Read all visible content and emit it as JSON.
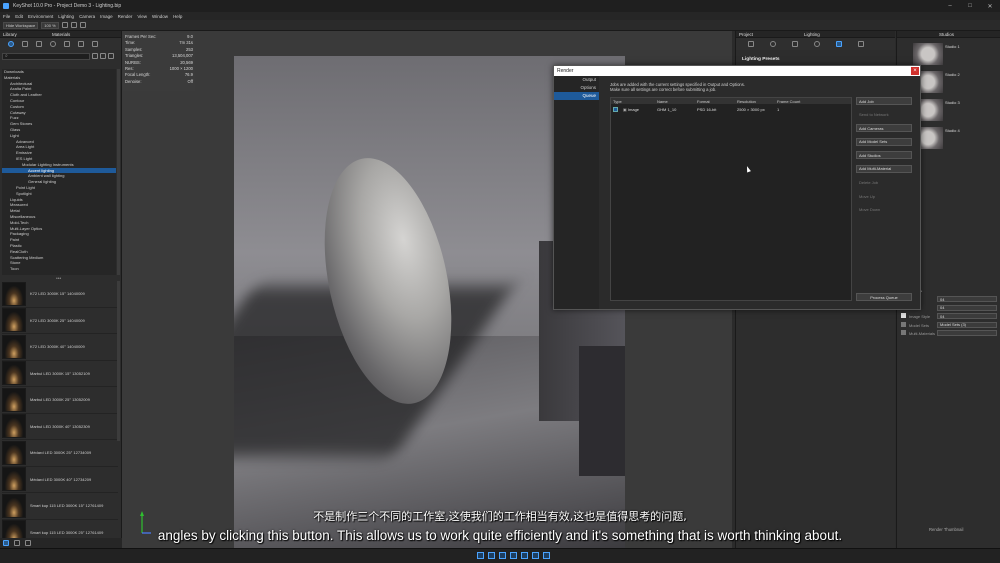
{
  "window": {
    "title": "KeyShot 10.0 Pro - Project Demo 3 - Lighting.bip",
    "controls": [
      "–",
      "□",
      "✕"
    ]
  },
  "menu": [
    "File",
    "Edit",
    "Environment",
    "Lighting",
    "Camera",
    "Image",
    "Render",
    "View",
    "Window",
    "Help"
  ],
  "toolbar": {
    "workspace": "Hide Workspace",
    "zoom": "100 %"
  },
  "library": {
    "panel_title": "Library",
    "tab_title": "Materials",
    "tree": [
      {
        "label": "Downloads",
        "indent": 0
      },
      {
        "label": "Materials",
        "indent": 0
      },
      {
        "label": "Architectural",
        "indent": 1
      },
      {
        "label": "Axalta Paint",
        "indent": 1
      },
      {
        "label": "Cloth and Leather",
        "indent": 1
      },
      {
        "label": "Contour",
        "indent": 1
      },
      {
        "label": "Custom",
        "indent": 1
      },
      {
        "label": "Cutaway",
        "indent": 1
      },
      {
        "label": "Fuzz",
        "indent": 1
      },
      {
        "label": "Gem Stones",
        "indent": 1
      },
      {
        "label": "Glass",
        "indent": 1
      },
      {
        "label": "Light",
        "indent": 1
      },
      {
        "label": "Advanced",
        "indent": 2
      },
      {
        "label": "Area Light",
        "indent": 2
      },
      {
        "label": "Emissive",
        "indent": 2
      },
      {
        "label": "IES Light",
        "indent": 2
      },
      {
        "label": "Modular Lighting Instruments",
        "indent": 3
      },
      {
        "label": "Accent lighting",
        "indent": 4,
        "selected": true
      },
      {
        "label": "Ambient wall lighting",
        "indent": 4
      },
      {
        "label": "General lighting",
        "indent": 4
      },
      {
        "label": "Point Light",
        "indent": 2
      },
      {
        "label": "Spotlight",
        "indent": 2
      },
      {
        "label": "Liquids",
        "indent": 1
      },
      {
        "label": "Measured",
        "indent": 1
      },
      {
        "label": "Metal",
        "indent": 1
      },
      {
        "label": "Miscellaneous",
        "indent": 1
      },
      {
        "label": "Mold-Tech",
        "indent": 1
      },
      {
        "label": "Multi-Layer Optics",
        "indent": 1
      },
      {
        "label": "Packaging",
        "indent": 1
      },
      {
        "label": "Paint",
        "indent": 1
      },
      {
        "label": "Plastic",
        "indent": 1
      },
      {
        "label": "RealCloth",
        "indent": 1
      },
      {
        "label": "Scattering Medium",
        "indent": 1
      },
      {
        "label": "Stone",
        "indent": 1
      },
      {
        "label": "Toon",
        "indent": 1
      }
    ],
    "thumbnails": [
      "K72 LED 3000K 15° 14040009",
      "K72 LED 3000K 25° 14040009",
      "K72 LED 3000K 40° 14040009",
      "Marbul LED 3000K 15° 13052109",
      "Marbul LED 3000K 25° 13052009",
      "Marbul LED 3000K 40° 13052309",
      "Médard LED 3000K 25° 12734009",
      "Médard LED 3000K 40° 12734209",
      "Smart kup 115 LED 3000K 15° 12761409",
      "Smart kup 115 LED 3000K 25° 12761409"
    ]
  },
  "hud": [
    {
      "k": "Frames Per Sec:",
      "v": "9.0"
    },
    {
      "k": "Time:",
      "v": "7m 31s"
    },
    {
      "k": "Samples:",
      "v": "253"
    },
    {
      "k": "Triangles:",
      "v": "13,504,007"
    },
    {
      "k": "NURBS:",
      "v": "20,569"
    },
    {
      "k": "Res:",
      "v": "1000 × 1200"
    },
    {
      "k": "Focal Length:",
      "v": "76.9"
    },
    {
      "k": "Denoise:",
      "v": "Off"
    }
  ],
  "render_dialog": {
    "title": "Render",
    "nav": [
      "Output",
      "Options",
      "Queue"
    ],
    "info_line1": "Jobs are added with the current settings specified in Output and Options.",
    "info_line2": "Make sure all settings are correct before submitting a job.",
    "columns": [
      "Type",
      "Name",
      "Format",
      "Resolution",
      "Frame Count"
    ],
    "jobs": [
      {
        "type": "Image",
        "name": "GHM 1_10",
        "format": "PSD 16-bit",
        "resolution": "2500 × 3000 px",
        "frames": "1"
      }
    ],
    "buttons": [
      {
        "label": "Add Job",
        "enabled": true
      },
      {
        "label": "Send to Network",
        "enabled": false
      },
      {
        "label": "Add Cameras",
        "enabled": true
      },
      {
        "label": "Add Model Sets",
        "enabled": true
      },
      {
        "label": "Add Studios",
        "enabled": true
      },
      {
        "label": "Add Multi-Material",
        "enabled": true
      },
      {
        "label": "Delete Job",
        "enabled": false
      },
      {
        "label": "Move Up",
        "enabled": false
      },
      {
        "label": "Move Down",
        "enabled": false
      }
    ],
    "process_label": "Process Queue"
  },
  "project_panel": {
    "title": "Project",
    "tab_title": "Lighting",
    "presets": "Lighting Presets"
  },
  "studios_panel": {
    "title": "Studios",
    "studios": [
      "Studio 1",
      "Studio 2",
      "Studio 3",
      "Studio 4"
    ],
    "props": [
      {
        "k": "",
        "v": "04"
      },
      {
        "k": "",
        "v": "04"
      },
      {
        "k": "Image Style",
        "v": "04",
        "checked": true
      },
      {
        "k": "Model Sets",
        "v": "Model Sets (3)",
        "checked": false
      },
      {
        "k": "Multi-Materials",
        "v": "",
        "checked": false
      }
    ],
    "render_thumb": "Render Thumbnail"
  },
  "subtitles": {
    "zh": "不是制作三个不同的工作室,这使我们的工作相当有效,这也是值得思考的问题,",
    "en": "angles by clicking this button. This allows us to work quite efficiently and it's something that is worth thinking about."
  },
  "colors": {
    "accent": "#1e5a9a",
    "close": "#d0312d"
  }
}
